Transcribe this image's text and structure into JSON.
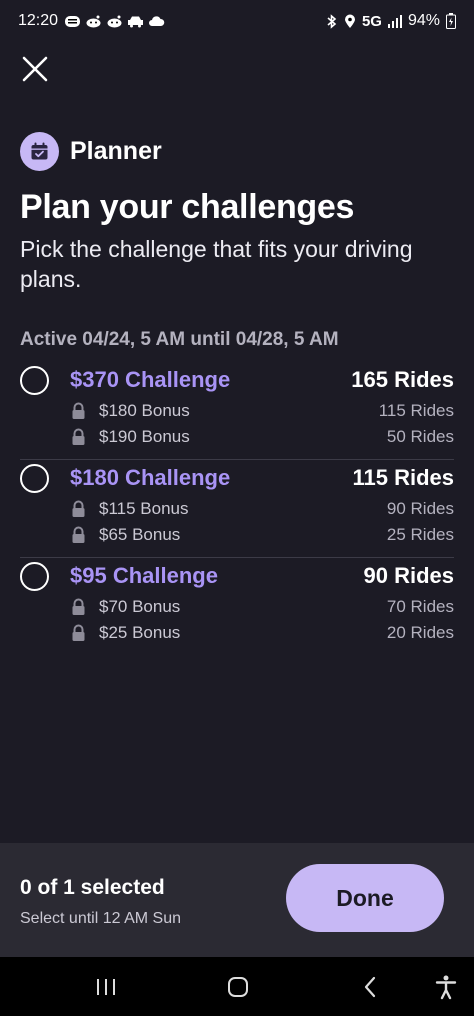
{
  "status_bar": {
    "time": "12:20",
    "network": "5G",
    "battery": "94%",
    "icons_left": [
      "message-icon",
      "reddit-icon",
      "reddit-icon",
      "car-icon",
      "cloud-icon"
    ],
    "icons_right": [
      "bluetooth-icon",
      "location-icon",
      "signal-icon",
      "battery-icon"
    ]
  },
  "header": {
    "planner_label": "Planner",
    "title": "Plan your challenges",
    "subtitle": "Pick the challenge that fits your driving plans."
  },
  "active_period": "Active 04/24, 5 AM until 04/28, 5 AM",
  "challenges": [
    {
      "name": "$370 Challenge",
      "rides": "165 Rides",
      "bonuses": [
        {
          "label": "$180 Bonus",
          "rides": "115 Rides"
        },
        {
          "label": "$190 Bonus",
          "rides": "50 Rides"
        }
      ]
    },
    {
      "name": "$180 Challenge",
      "rides": "115 Rides",
      "bonuses": [
        {
          "label": "$115 Bonus",
          "rides": "90 Rides"
        },
        {
          "label": "$65 Bonus",
          "rides": "25 Rides"
        }
      ]
    },
    {
      "name": "$95 Challenge",
      "rides": "90 Rides",
      "bonuses": [
        {
          "label": "$70 Bonus",
          "rides": "70 Rides"
        },
        {
          "label": "$25 Bonus",
          "rides": "20 Rides"
        }
      ]
    }
  ],
  "footer": {
    "selected_count": "0 of 1 selected",
    "select_until": "Select until 12 AM Sun",
    "done_label": "Done"
  },
  "colors": {
    "background": "#1c1b25",
    "accent": "#a994f5",
    "button": "#c7b8f5",
    "footer": "#2b2a33"
  }
}
